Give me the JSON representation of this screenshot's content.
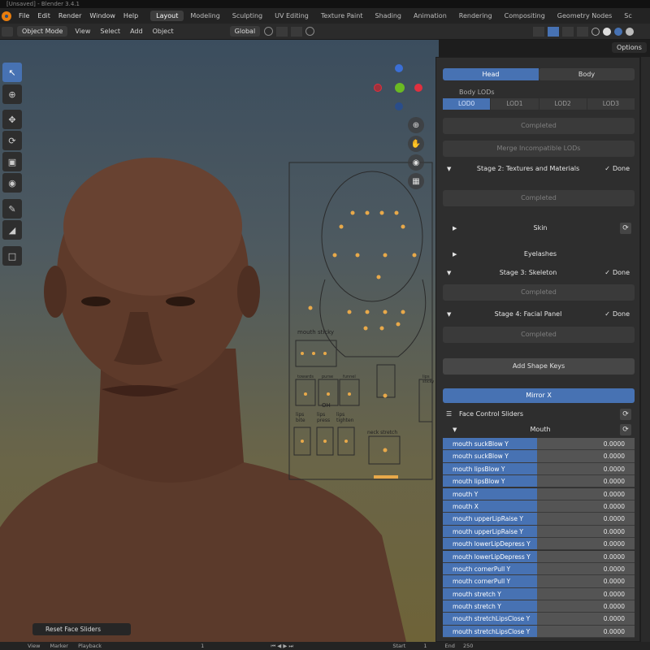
{
  "window_title": "[Unsaved] - Blender 3.4.1",
  "menu": [
    "File",
    "Edit",
    "Render",
    "Window",
    "Help"
  ],
  "workspaces": [
    "Layout",
    "Modeling",
    "Sculpting",
    "UV Editing",
    "Texture Paint",
    "Shading",
    "Animation",
    "Rendering",
    "Compositing",
    "Geometry Nodes",
    "Sc"
  ],
  "active_workspace": "Layout",
  "header": {
    "mode": "Object Mode",
    "items": [
      "View",
      "Select",
      "Add",
      "Object"
    ],
    "orientation": "Global",
    "options_label": "Options"
  },
  "viewport": {
    "gizmo_axes": [
      "X",
      "Y",
      "Z"
    ],
    "face_panel_labels": {
      "mouth_sticky": "mouth sticky",
      "oh": "OH",
      "lips_bite": "lips bite",
      "lips_press": "lips press",
      "lips_tighten": "lips tighten",
      "neck_stretch": "neck stretch",
      "lips_sticky": "lips sticky",
      "purse": "purse",
      "funnel": "funnel",
      "towards": "towards"
    },
    "reset_button": "Reset Face Sliders"
  },
  "panel": {
    "tabs": [
      {
        "label": "Head",
        "active": true
      },
      {
        "label": "Body",
        "active": false
      }
    ],
    "body_lods_label": "Body LODs",
    "lods": [
      {
        "label": "LOD0",
        "active": true
      },
      {
        "label": "LOD1",
        "active": false
      },
      {
        "label": "LOD2",
        "active": false
      },
      {
        "label": "LOD3",
        "active": false
      }
    ],
    "completed_label": "Completed",
    "merge_label": "Merge Incompatible LODs",
    "stage2": {
      "title": "Stage 2: Textures and Materials",
      "status": "Done"
    },
    "skin_label": "Skin",
    "eyelashes_label": "Eyelashes",
    "stage3": {
      "title": "Stage 3: Skeleton",
      "status": "Done"
    },
    "stage4": {
      "title": "Stage 4: Facial Panel",
      "status": "Done"
    },
    "add_shape_keys": "Add Shape Keys",
    "mirror_label": "Mirror X",
    "face_control_sliders": "Face Control Sliders",
    "mouth_label": "Mouth",
    "sliders": [
      {
        "label": "mouth suckBlow Y",
        "value": "0.0000"
      },
      {
        "label": "mouth suckBlow Y",
        "value": "0.0000"
      },
      {
        "label": "mouth lipsBlow Y",
        "value": "0.0000"
      },
      {
        "label": "mouth lipsBlow Y",
        "value": "0.0000"
      },
      {
        "label": "mouth Y",
        "value": "0.0000"
      },
      {
        "label": "mouth X",
        "value": "0.0000"
      },
      {
        "label": "mouth upperLipRaise Y",
        "value": "0.0000"
      },
      {
        "label": "mouth upperLipRaise Y",
        "value": "0.0000"
      },
      {
        "label": "mouth lowerLipDepress Y",
        "value": "0.0000"
      },
      {
        "label": "mouth lowerLipDepress Y",
        "value": "0.0000"
      },
      {
        "label": "mouth cornerPull Y",
        "value": "0.0000"
      },
      {
        "label": "mouth cornerPull Y",
        "value": "0.0000"
      },
      {
        "label": "mouth stretch Y",
        "value": "0.0000"
      },
      {
        "label": "mouth stretch Y",
        "value": "0.0000"
      },
      {
        "label": "mouth stretchLipsClose Y",
        "value": "0.0000"
      },
      {
        "label": "mouth stretchLipsClose Y",
        "value": "0.0000"
      }
    ]
  },
  "timeline": {
    "items": [
      "View",
      "Marker",
      "Playback"
    ],
    "current_frame": "1",
    "start_label": "Start",
    "start_value": "1",
    "end_label": "End",
    "end_value": "250"
  },
  "colors": {
    "accent": "#4772b3",
    "axis_x": "#e0303f",
    "axis_y": "#6aba23",
    "axis_z": "#3b6fd6"
  }
}
